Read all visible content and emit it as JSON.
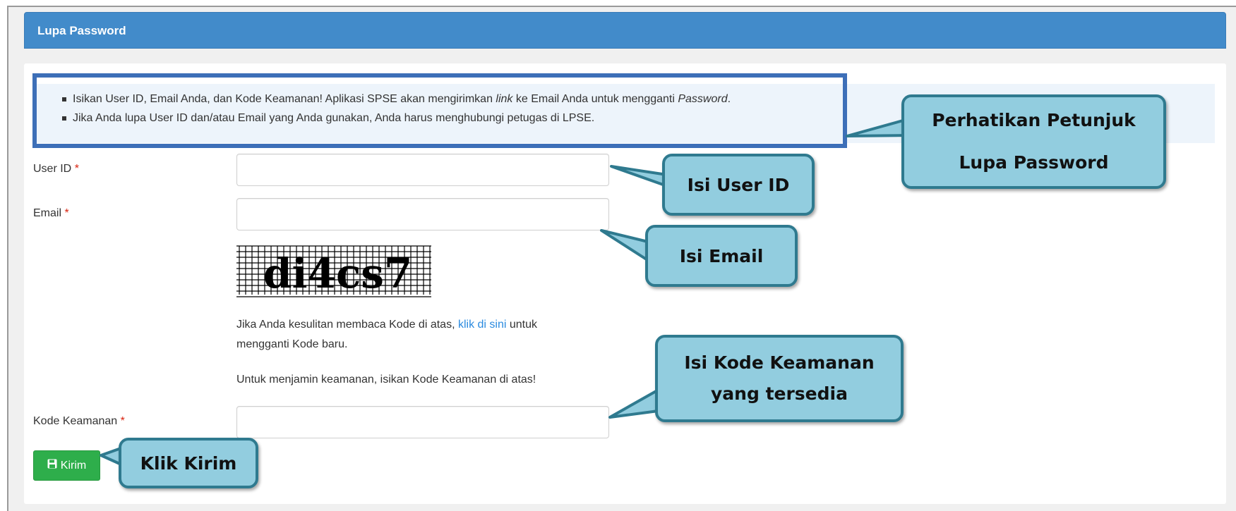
{
  "panel": {
    "title": "Lupa Password"
  },
  "info": {
    "line1_prefix": "Isikan User ID, Email Anda, dan Kode Keamanan! Aplikasi SPSE akan mengirimkan ",
    "line1_link_word": "link",
    "line1_middle": " ke Email Anda untuk mengganti ",
    "line1_password_word": "Password",
    "line1_suffix": ".",
    "line2": "Jika Anda lupa User ID dan/atau Email yang Anda gunakan, Anda harus menghubungi petugas di LPSE."
  },
  "form": {
    "user_id_label": "User ID",
    "email_label": "Email",
    "kode_label": "Kode Keamanan",
    "required_mark": "*",
    "user_id_value": "",
    "email_value": "",
    "kode_value": "",
    "captcha_text": "di4cs7",
    "help_prefix": "Jika Anda kesulitan membaca Kode di atas, ",
    "help_link": "klik di sini",
    "help_suffix": " untuk",
    "help_line2": "mengganti Kode baru.",
    "security_note": "Untuk menjamin keamanan, isikan Kode Keamanan di atas!",
    "submit_label": "Kirim",
    "submit_icon": "save-icon"
  },
  "callouts": {
    "petunjuk_line1": "Perhatikan Petunjuk",
    "petunjuk_line2": "Lupa Password",
    "user_id": "Isi User ID",
    "email": "Isi Email",
    "kode_line1": "Isi Kode Keamanan",
    "kode_line2": "yang tersedia",
    "kirim": "Klik Kirim"
  },
  "colors": {
    "header": "#428bca",
    "callout_fill": "#92cddf",
    "callout_border": "#2f7a8f",
    "info_highlight_border": "#3d6fb8",
    "submit": "#2eae4b",
    "link": "#2a8adf",
    "required": "#d9230f"
  }
}
